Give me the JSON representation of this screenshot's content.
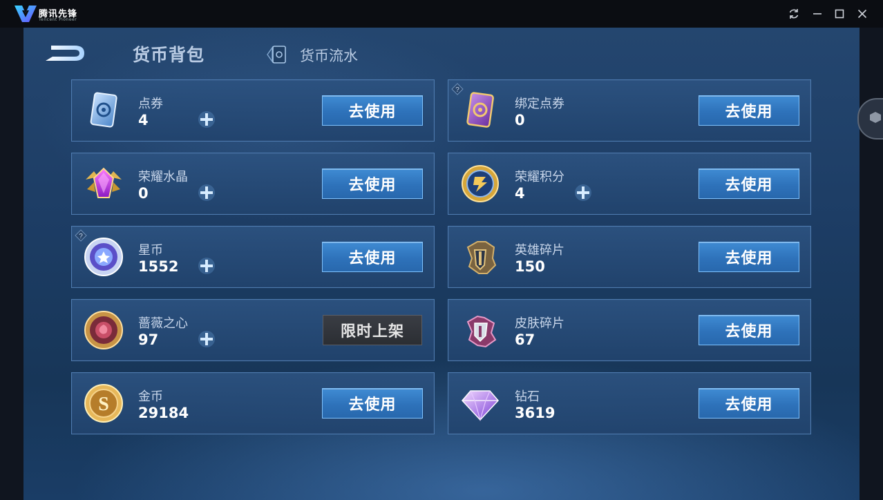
{
  "app": {
    "logo_text": "腾讯先锋",
    "logo_subtext": "Tencent Pioneer"
  },
  "window_controls": [
    "refresh-icon",
    "minimize-icon",
    "maximize-icon",
    "close-icon"
  ],
  "header": {
    "title": "货币背包",
    "flow_tab_label": "货币流水"
  },
  "currencies": [
    {
      "name": "点券",
      "count": "4",
      "button": "去使用",
      "icon": "coupon-card-icon",
      "has_plus": true,
      "has_help": false
    },
    {
      "name": "绑定点券",
      "count": "0",
      "button": "去使用",
      "icon": "bound-coupon-card-icon",
      "has_plus": false,
      "has_help": true
    },
    {
      "name": "荣耀水晶",
      "count": "0",
      "button": "去使用",
      "icon": "glory-crystal-icon",
      "has_plus": true,
      "has_help": false
    },
    {
      "name": "荣耀积分",
      "count": "4",
      "button": "去使用",
      "icon": "glory-points-icon",
      "has_plus": true,
      "has_help": false
    },
    {
      "name": "星币",
      "count": "1552",
      "button": "去使用",
      "icon": "star-coin-icon",
      "has_plus": true,
      "has_help": true
    },
    {
      "name": "英雄碎片",
      "count": "150",
      "button": "去使用",
      "icon": "hero-fragment-icon",
      "has_plus": false,
      "has_help": false
    },
    {
      "name": "蔷薇之心",
      "count": "97",
      "button": "限时上架",
      "icon": "rose-heart-icon",
      "has_plus": true,
      "has_help": false,
      "disabled": true
    },
    {
      "name": "皮肤碎片",
      "count": "67",
      "button": "去使用",
      "icon": "skin-fragment-icon",
      "has_plus": false,
      "has_help": false
    },
    {
      "name": "金币",
      "count": "29184",
      "button": "去使用",
      "icon": "gold-coin-icon",
      "has_plus": false,
      "has_help": false
    },
    {
      "name": "钻石",
      "count": "3619",
      "button": "去使用",
      "icon": "diamond-icon",
      "has_plus": false,
      "has_help": false
    }
  ],
  "colors": {
    "background": "#1d3d65",
    "card": "#2a5080",
    "button": "#2e72ba",
    "button_border": "#7fc3ff",
    "disabled_button": "#2b2e33"
  }
}
